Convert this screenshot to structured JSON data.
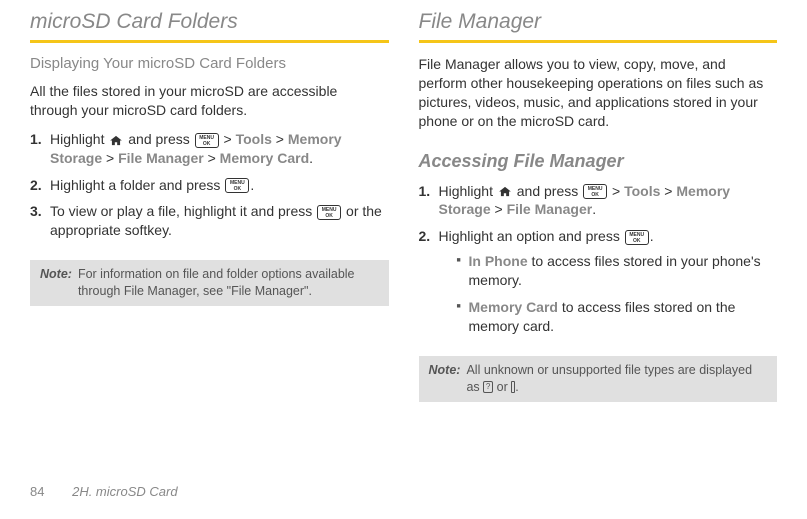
{
  "left": {
    "title": "microSD Card Folders",
    "subheading": "Displaying Your microSD Card Folders",
    "intro": "All the files stored in your microSD are accessible through your microSD card folders.",
    "step1_a": "Highlight ",
    "step1_b": " and press ",
    "step1_c": " > ",
    "tools": "Tools",
    "gt1": " > ",
    "memstorage": "Memory Storage",
    "gt2": " > ",
    "filemanager": "File Manager",
    "gt3": " > ",
    "memcard": "Memory Card",
    "period": ".",
    "step2_a": "Highlight a folder and press ",
    "step2_b": ".",
    "step3_a": "To view or play a file, highlight it and press ",
    "step3_b": " or the appropriate softkey.",
    "note_label": "Note:",
    "note_text": "For information on file and folder options available through File Manager, see \"File Manager\"."
  },
  "right": {
    "title": "File Manager",
    "intro": "File Manager allows you to view, copy, move, and perform other housekeeping operations on files such as pictures, videos, music, and applications stored in your phone or on the microSD card.",
    "sub": "Accessing File Manager",
    "step1_a": "Highlight ",
    "step1_b": " and press ",
    "step1_c": " > ",
    "tools": "Tools",
    "gt1": " > ",
    "memstorage": "Memory Storage",
    "gt2": " > ",
    "filemanager": "File Manager",
    "period": ".",
    "step2_a": "Highlight an option and press ",
    "step2_b": ".",
    "bullet1_bold": "In Phone",
    "bullet1_rest": " to access files stored in your phone's memory.",
    "bullet2_bold": "Memory Card",
    "bullet2_rest": " to access files stored on the memory card.",
    "note_label": "Note:",
    "note_text_a": "All unknown or unsupported file types are displayed as ",
    "note_text_b": " or ",
    "note_text_c": "."
  },
  "footer": {
    "page": "84",
    "section": "2H. microSD Card"
  },
  "icons": {
    "menu": "MENU",
    "ok": "OK"
  }
}
